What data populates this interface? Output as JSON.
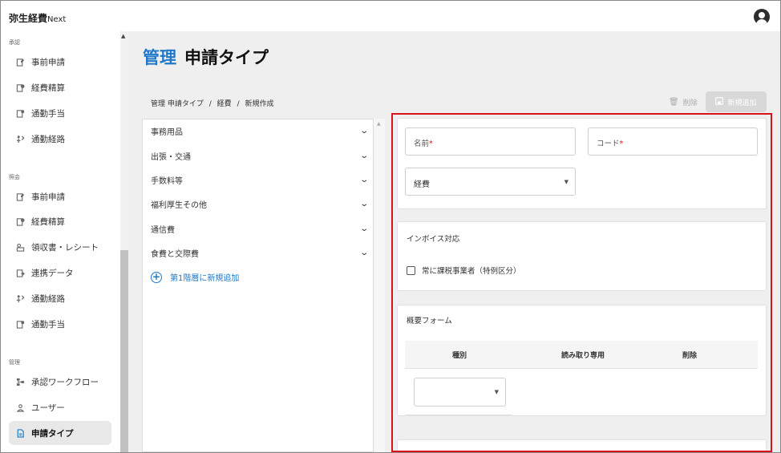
{
  "app": {
    "brand": "弥生経費",
    "brand_suffix": "Next"
  },
  "sidebar": {
    "sections": [
      {
        "label": "承認",
        "items": [
          {
            "label": "事前申請",
            "icon": "pre-application-icon"
          },
          {
            "label": "経費精算",
            "icon": "expense-settlement-icon"
          },
          {
            "label": "通勤手当",
            "icon": "commute-allowance-icon"
          },
          {
            "label": "通勤経路",
            "icon": "commute-route-icon"
          }
        ]
      },
      {
        "label": "照会",
        "items": [
          {
            "label": "事前申請",
            "icon": "pre-application-icon"
          },
          {
            "label": "経費精算",
            "icon": "expense-settlement-icon"
          },
          {
            "label": "領収書・レシート",
            "icon": "receipt-icon"
          },
          {
            "label": "連携データ",
            "icon": "linked-data-icon"
          },
          {
            "label": "通勤経路",
            "icon": "commute-route-icon"
          },
          {
            "label": "通勤手当",
            "icon": "commute-allowance-icon"
          }
        ]
      },
      {
        "label": "管理",
        "items": [
          {
            "label": "承認ワークフロー",
            "icon": "workflow-icon"
          },
          {
            "label": "ユーザー",
            "icon": "user-icon"
          },
          {
            "label": "申請タイプ",
            "icon": "application-type-icon",
            "active": true
          }
        ]
      }
    ]
  },
  "page": {
    "title_prefix": "管理",
    "title": "申請タイプ"
  },
  "breadcrumb": [
    "管理 申請タイプ",
    "/",
    "経費",
    "/",
    "新規作成"
  ],
  "toolbar": {
    "delete_label": "削除",
    "add_label": "新規追加"
  },
  "tree": {
    "items": [
      "事務用品",
      "出張・交通",
      "手数料等",
      "福利厚生その他",
      "通信費",
      "食費と交際費"
    ],
    "add_label": "第1階層に新規追加"
  },
  "form": {
    "name_placeholder": "名前",
    "code_placeholder": "コード",
    "required_mark": "*",
    "category_value": "経費",
    "invoice": {
      "title": "インボイス対応",
      "checkbox_label": "常に課税事業者（特例区分）",
      "checked": false
    },
    "summary": {
      "title": "概要フォーム",
      "columns": [
        "種別",
        "読み取り専用",
        "削除"
      ]
    }
  },
  "colors": {
    "accent": "#1f78c8",
    "highlight_border": "#d8131c",
    "active_nav": "#e8e8e8",
    "disabled_button": "#d8d8d8"
  }
}
